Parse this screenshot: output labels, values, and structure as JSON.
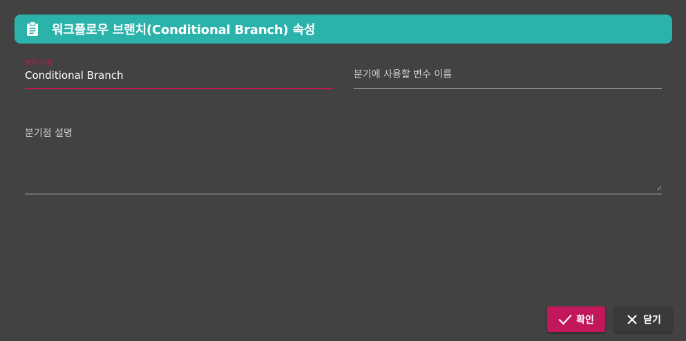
{
  "header": {
    "title": "워크플로우 브랜치(Conditional Branch) 속성",
    "icon": "clipboard-icon"
  },
  "form": {
    "branch_name": {
      "label": "분기 이름",
      "value": "Conditional Branch"
    },
    "variable_name": {
      "placeholder": "분기에 사용할 변수 이름",
      "value": ""
    },
    "description": {
      "placeholder": "분기점 설명",
      "value": ""
    }
  },
  "actions": {
    "confirm_label": "확인",
    "confirm_icon": "check-icon",
    "close_label": "닫기",
    "close_icon": "close-icon"
  },
  "colors": {
    "header_bg": "#2bb3ab",
    "accent": "#c2185b",
    "dialog_bg": "#424242"
  }
}
